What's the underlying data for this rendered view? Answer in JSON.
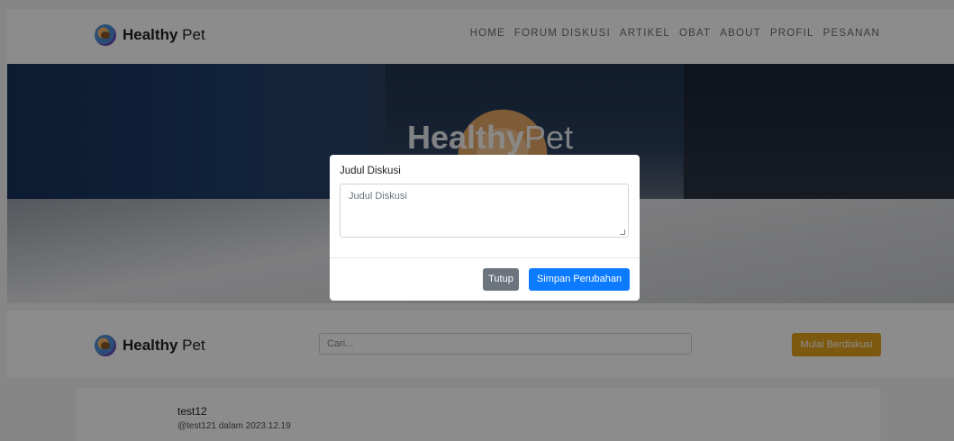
{
  "nav": {
    "brand_bold": "Healthy",
    "brand_rest": " Pet",
    "links": [
      "HOME",
      "FORUM DISKUSI",
      "ARTIKEL",
      "OBAT",
      "ABOUT",
      "PROFIL",
      "PESANAN"
    ]
  },
  "hero": {
    "title_bold": "Healthy",
    "title_rest": "Pet"
  },
  "forum": {
    "brand_bold": "Healthy",
    "brand_rest": " Pet",
    "search_placeholder": "Cari...",
    "start_button": "Mulai Berdiskusi"
  },
  "post": {
    "username": "test12",
    "meta": "@test121 dalam 2023.12.19"
  },
  "modal": {
    "label": "Judul Diskusi",
    "textarea_placeholder": "Judul Diskusi",
    "close_button": "Tutup",
    "save_button": "Simpan Perubahan"
  },
  "colors": {
    "primary": "#0d7bff",
    "secondary": "#6c757d",
    "accent": "#e3a21c"
  }
}
